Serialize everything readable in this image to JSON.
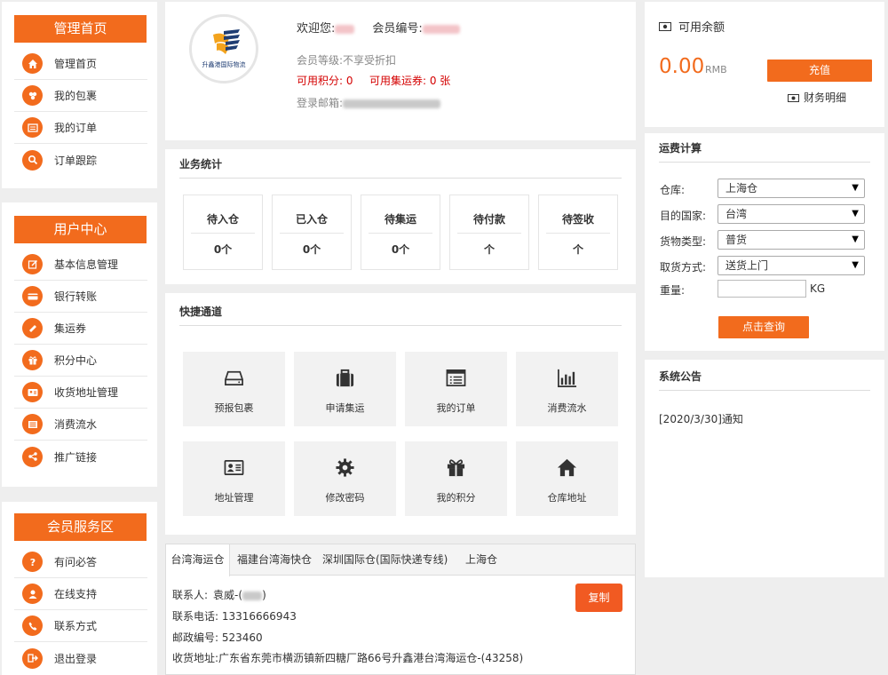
{
  "sidebar": {
    "groups": [
      {
        "title": "管理首页",
        "items": [
          {
            "label": "管理首页",
            "icon": "home-icon"
          },
          {
            "label": "我的包裹",
            "icon": "package-icon"
          },
          {
            "label": "我的订单",
            "icon": "order-icon"
          },
          {
            "label": "订单跟踪",
            "icon": "search-icon"
          }
        ]
      },
      {
        "title": "用户中心",
        "items": [
          {
            "label": "基本信息管理",
            "icon": "edit-icon"
          },
          {
            "label": "银行转账",
            "icon": "credit-card-icon"
          },
          {
            "label": "集运券",
            "icon": "ticket-icon"
          },
          {
            "label": "积分中心",
            "icon": "gift-icon"
          },
          {
            "label": "收货地址管理",
            "icon": "id-card-icon"
          },
          {
            "label": "消费流水",
            "icon": "list-icon"
          },
          {
            "label": "推广链接",
            "icon": "share-icon"
          }
        ]
      },
      {
        "title": "会员服务区",
        "items": [
          {
            "label": "有问必答",
            "icon": "question-icon"
          },
          {
            "label": "在线支持",
            "icon": "user-icon"
          },
          {
            "label": "联系方式",
            "icon": "phone-icon"
          },
          {
            "label": "退出登录",
            "icon": "logout-icon"
          }
        ]
      }
    ]
  },
  "profile": {
    "welcome_label": "欢迎您:",
    "member_no_label": "会员编号:",
    "level": "会员等级:不享受折扣",
    "points": "可用积分:  0",
    "coupons": "可用集运券:  0 张",
    "email_label": "登录邮箱:",
    "logo_text": "升鑫港国际物流"
  },
  "balance": {
    "title": "可用余额",
    "amount": "0.00",
    "currency": "RMB",
    "recharge_label": "充值",
    "details_label": "财务明细"
  },
  "stats": {
    "title": "业务统计",
    "items": [
      {
        "label": "待入仓",
        "value": "0个"
      },
      {
        "label": "已入仓",
        "value": "0个"
      },
      {
        "label": "待集运",
        "value": "0个"
      },
      {
        "label": "待付款",
        "value": "个"
      },
      {
        "label": "待签收",
        "value": "个"
      }
    ]
  },
  "quick": {
    "title": "快捷通道",
    "items": [
      {
        "label": "预报包裹",
        "icon": "drive-icon"
      },
      {
        "label": "申请集运",
        "icon": "suitcase-icon"
      },
      {
        "label": "我的订单",
        "icon": "list-window-icon"
      },
      {
        "label": "消费流水",
        "icon": "bar-chart-icon"
      },
      {
        "label": "地址管理",
        "icon": "address-card-icon"
      },
      {
        "label": "修改密码",
        "icon": "cog-icon"
      },
      {
        "label": "我的积分",
        "icon": "gift-icon"
      },
      {
        "label": "仓库地址",
        "icon": "home-icon"
      }
    ]
  },
  "warehouse": {
    "tabs": [
      "台湾海运仓",
      "福建台湾海快仓",
      "深圳国际仓(国际快递专线)",
      "上海仓"
    ],
    "contact_label": "联系人:",
    "contact_value": "袁威-(",
    "contact_suffix": ")",
    "phone": "联系电话:  13316666943",
    "postal": "邮政编号:  523460",
    "address": "收货地址:广东省东莞市横沥镇新四糖厂路66号升鑫港台湾海运仓-(43258)",
    "copy_label": "复制"
  },
  "calc": {
    "title": "运费计算",
    "fields": [
      {
        "label": "仓库:",
        "value": "上海仓"
      },
      {
        "label": "目的国家:",
        "value": "台湾"
      },
      {
        "label": "货物类型:",
        "value": "普货"
      },
      {
        "label": "取货方式:",
        "value": "送货上门"
      }
    ],
    "weight_label": "重量:",
    "weight_unit": "KG",
    "weight_value": "",
    "query_label": "点击查询"
  },
  "notice": {
    "title": "系统公告",
    "items": [
      "[2020/3/30]通知"
    ]
  },
  "colors": {
    "accent": "#f26b1d",
    "danger": "#d40000"
  }
}
